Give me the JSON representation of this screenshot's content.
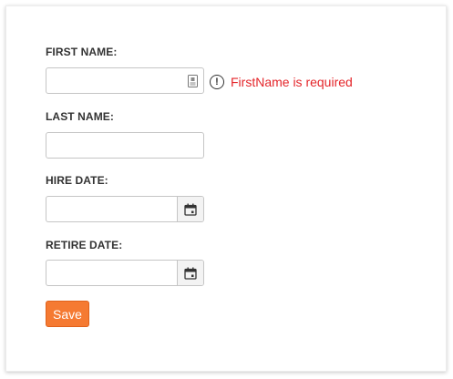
{
  "form": {
    "first_name": {
      "label": "FIRST NAME:",
      "value": "",
      "icon": "contact-card-icon",
      "error_icon": "!",
      "error_text": "FirstName is required"
    },
    "last_name": {
      "label": "LAST NAME:",
      "value": ""
    },
    "hire_date": {
      "label": "HIRE DATE:",
      "value": "",
      "icon": "calendar-icon"
    },
    "retire_date": {
      "label": "RETIRE DATE:",
      "value": "",
      "icon": "calendar-icon"
    },
    "save_label": "Save"
  },
  "colors": {
    "error": "#e4252a",
    "primary_button": "#f57a32",
    "label_text": "#333333"
  }
}
